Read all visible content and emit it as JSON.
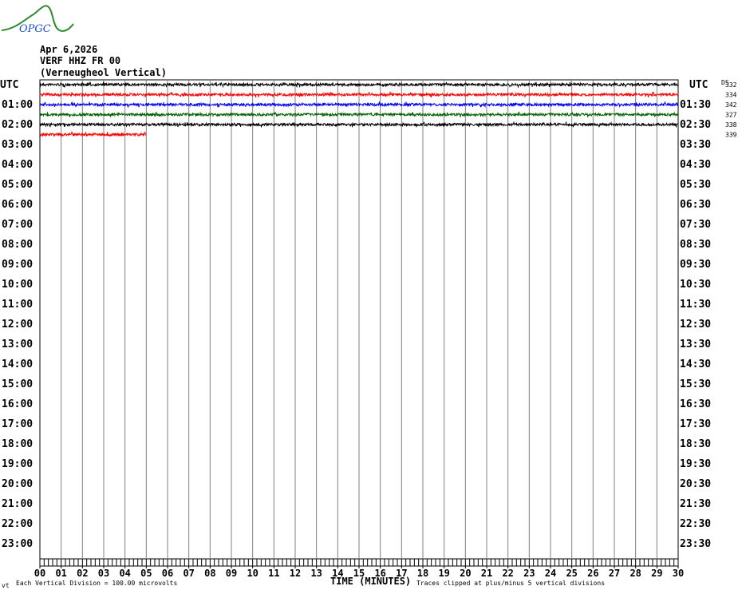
{
  "logo": {
    "text": "OPGC",
    "colors": {
      "curve": "#2e8b2e",
      "text": "#1e50c8"
    }
  },
  "header": {
    "date": "Apr 6,2026",
    "station": "VERF HHZ FR 00",
    "description": "(Verneugheol Vertical)"
  },
  "chart_data": {
    "type": "line",
    "subtype": "helicorder",
    "xlabel": "TIME (MINUTES)",
    "x_ticks": [
      "00",
      "01",
      "02",
      "03",
      "04",
      "05",
      "06",
      "07",
      "08",
      "09",
      "10",
      "11",
      "12",
      "13",
      "14",
      "15",
      "16",
      "17",
      "18",
      "19",
      "20",
      "21",
      "22",
      "23",
      "24",
      "25",
      "26",
      "27",
      "28",
      "29",
      "30"
    ],
    "xlim": [
      0,
      30
    ],
    "left_axis_title": "UTC",
    "right_axis_title": "UTC",
    "left_labels": [
      "",
      "01:00",
      "02:00",
      "03:00",
      "04:00",
      "05:00",
      "06:00",
      "07:00",
      "08:00",
      "09:00",
      "10:00",
      "11:00",
      "12:00",
      "13:00",
      "14:00",
      "15:00",
      "16:00",
      "17:00",
      "18:00",
      "19:00",
      "20:00",
      "21:00",
      "22:00",
      "23:00"
    ],
    "right_labels": [
      "",
      "01:30",
      "02:30",
      "03:30",
      "04:30",
      "05:30",
      "06:30",
      "07:30",
      "08:30",
      "09:30",
      "10:30",
      "11:30",
      "12:30",
      "13:30",
      "14:30",
      "15:30",
      "16:30",
      "17:30",
      "18:30",
      "19:30",
      "20:30",
      "21:30",
      "22:30",
      "23:30"
    ],
    "grid": true,
    "ds_header": "DS",
    "traces": [
      {
        "color": "#000000",
        "ds": "332",
        "minutes": 30
      },
      {
        "color": "#ff0000",
        "ds": "334",
        "minutes": 30
      },
      {
        "color": "#0000ff",
        "ds": "342",
        "minutes": 30
      },
      {
        "color": "#006400",
        "ds": "327",
        "minutes": 30
      },
      {
        "color": "#000000",
        "ds": "338",
        "minutes": 30
      },
      {
        "color": "#ff0000",
        "ds": "339",
        "minutes": 5
      }
    ]
  },
  "footer": {
    "corner_mark": "vt",
    "scale_note": "Each Vertical Division =  100.00 microvolts",
    "clip_note": "Traces clipped at plus/minus 5 vertical divisions"
  }
}
